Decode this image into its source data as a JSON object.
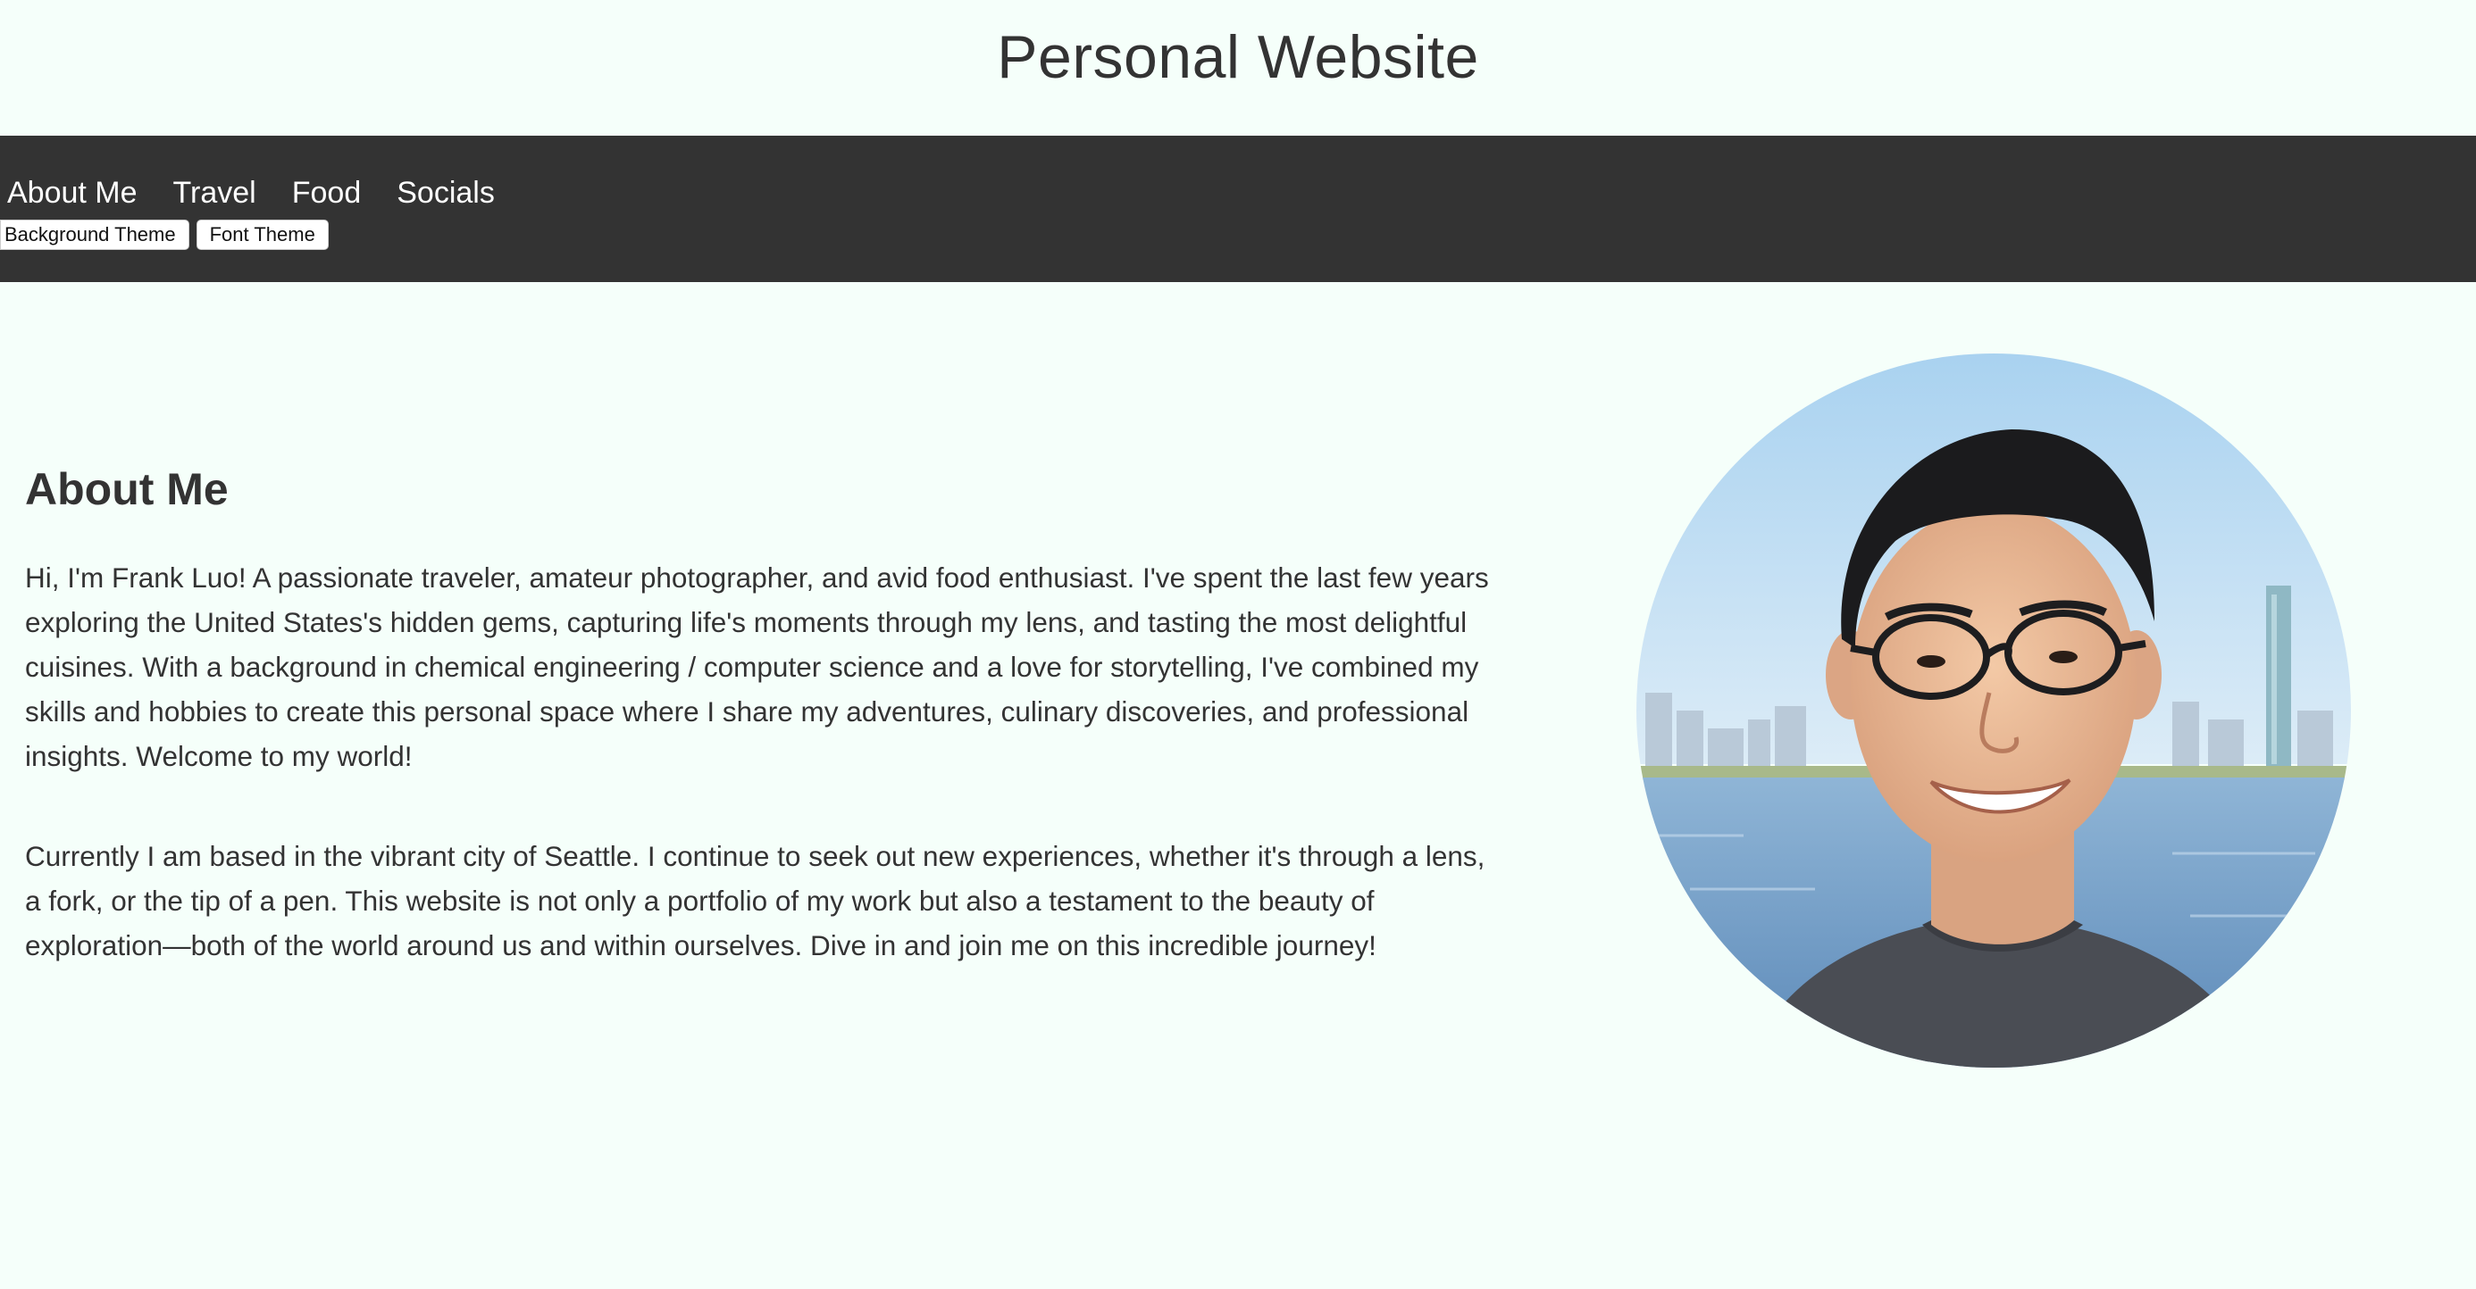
{
  "header": {
    "title": "Personal Website"
  },
  "nav": {
    "items": [
      {
        "label": "About Me"
      },
      {
        "label": "Travel"
      },
      {
        "label": "Food"
      },
      {
        "label": "Socials"
      }
    ],
    "theme_buttons": {
      "background": "Background Theme",
      "font": "Font Theme"
    }
  },
  "about": {
    "heading": "About Me",
    "paragraphs": [
      "Hi, I'm Frank Luo! A passionate traveler, amateur photographer, and avid food enthusiast. I've spent the last few years exploring the United States's hidden gems, capturing life's moments through my lens, and tasting the most delightful cuisines. With a background in chemical engineering / computer science and a love for storytelling, I've combined my skills and hobbies to create this personal space where I share my adventures, culinary discoveries, and professional insights. Welcome to my world!",
      "Currently I am based in the vibrant city of Seattle. I continue to seek out new experiences, whether it's through a lens, a fork, or the tip of a pen. This website is not only a portfolio of my work but also a testament to the beauty of exploration—both of the world around us and within ourselves. Dive in and join me on this incredible journey!"
    ]
  },
  "colors": {
    "page_background": "#f5fffa",
    "navbar_background": "#333333",
    "text": "#333333",
    "nav_text": "#ffffff"
  }
}
